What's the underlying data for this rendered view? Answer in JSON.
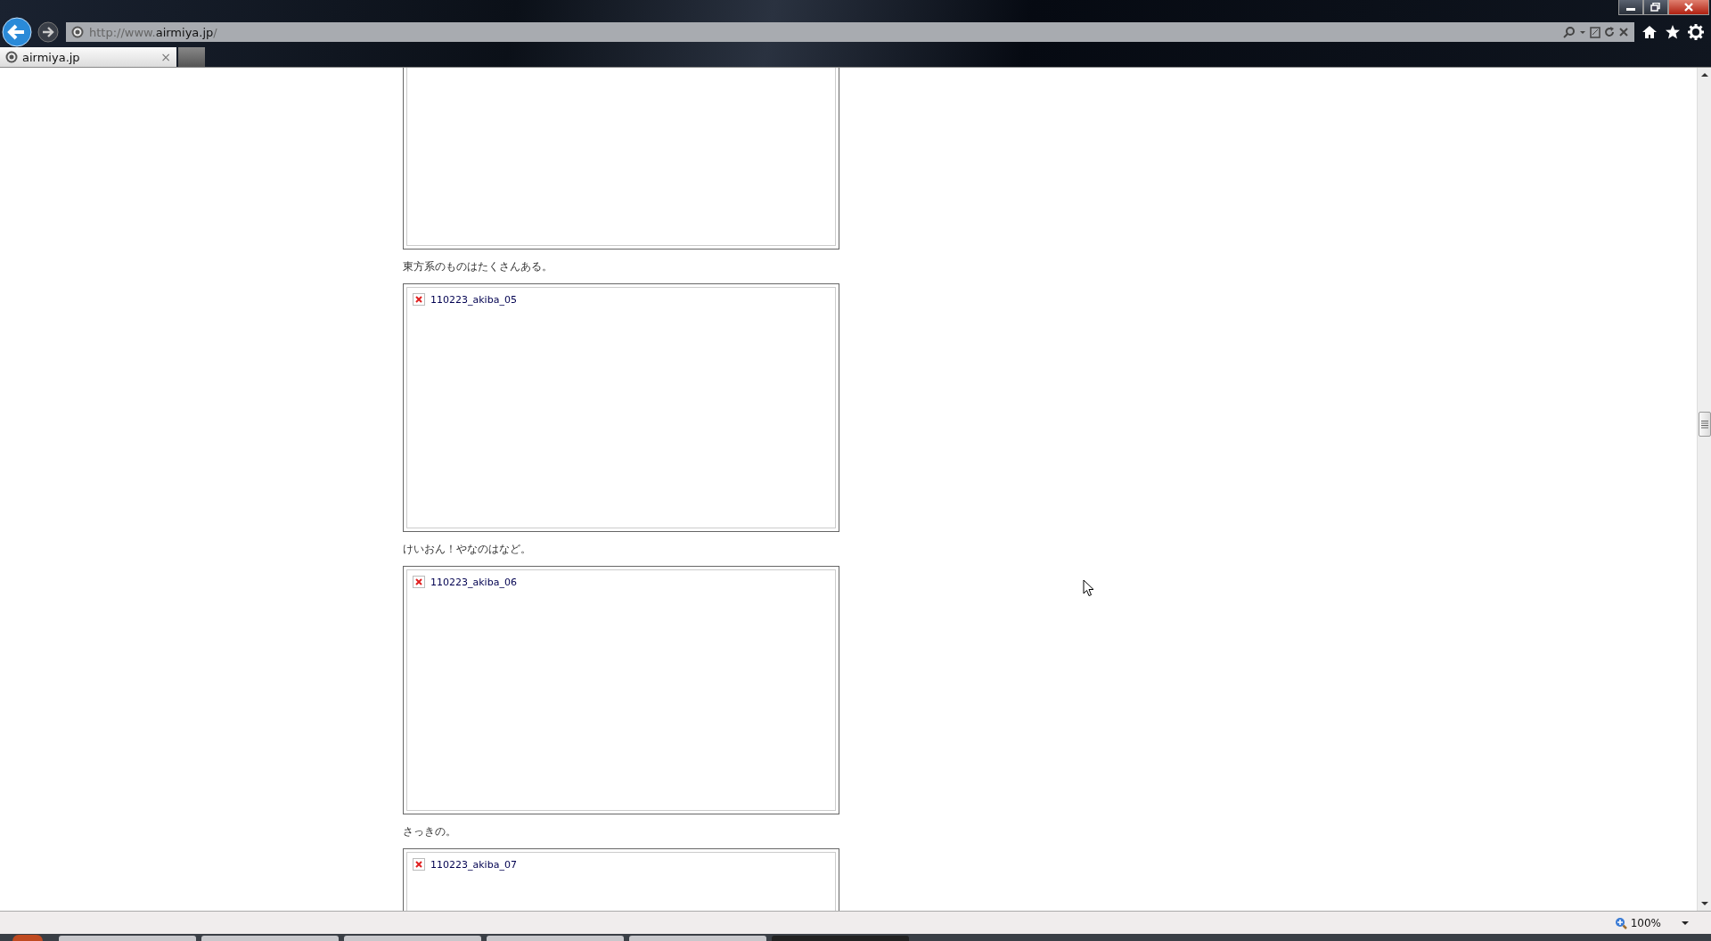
{
  "address_bar": {
    "prefix": "http://www.",
    "domain": "airmiya.jp",
    "suffix": "/"
  },
  "tabs": [
    {
      "label": "airmiya.jp",
      "selected": true,
      "close": "×"
    }
  ],
  "content": [
    {
      "kind": "image-top-cut"
    },
    {
      "kind": "caption",
      "text": "東方系のものはたくさんある。"
    },
    {
      "kind": "image",
      "alt": "110223_akiba_05"
    },
    {
      "kind": "caption",
      "text": "けいおん！やなのはなど。"
    },
    {
      "kind": "image",
      "alt": "110223_akiba_06"
    },
    {
      "kind": "caption",
      "text": "さっきの。"
    },
    {
      "kind": "image",
      "alt": "110223_akiba_07"
    }
  ],
  "status_bar": {
    "zoom": "100%"
  }
}
